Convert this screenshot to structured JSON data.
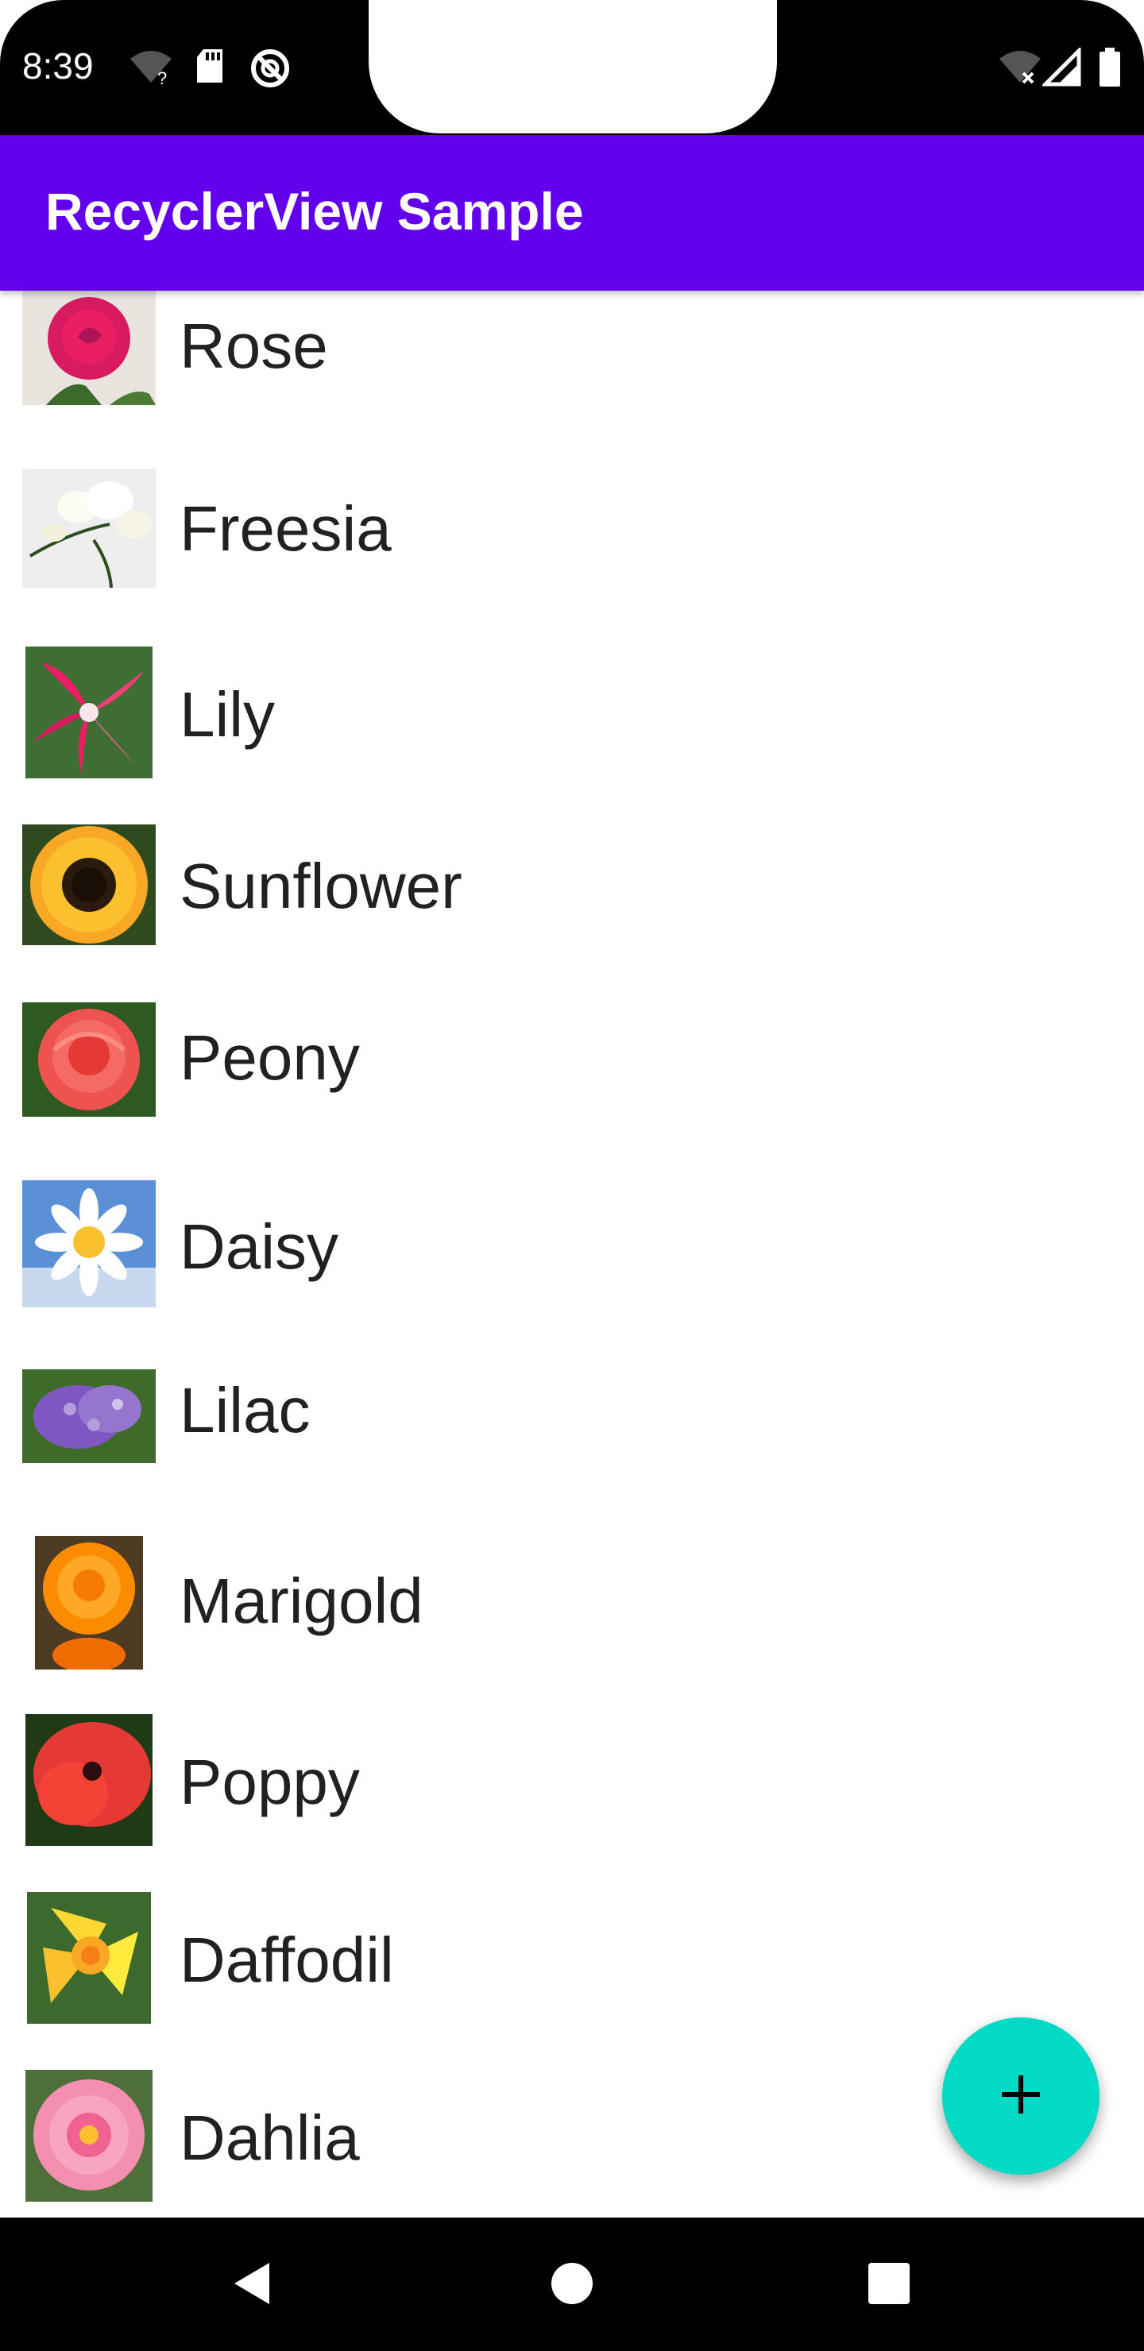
{
  "status_bar": {
    "time": "8:39",
    "icons": [
      "wifi-question-icon",
      "sd-card-icon",
      "do-not-disturb-icon",
      "wifi-off-icon",
      "cell-signal-icon",
      "battery-icon"
    ]
  },
  "app_bar": {
    "title": "RecyclerView Sample",
    "color": "#6200EE"
  },
  "flowers": [
    {
      "name": "Rose",
      "icon": "rose-image"
    },
    {
      "name": "Freesia",
      "icon": "freesia-image"
    },
    {
      "name": "Lily",
      "icon": "lily-image"
    },
    {
      "name": "Sunflower",
      "icon": "sunflower-image"
    },
    {
      "name": "Peony",
      "icon": "peony-image"
    },
    {
      "name": "Daisy",
      "icon": "daisy-image"
    },
    {
      "name": "Lilac",
      "icon": "lilac-image"
    },
    {
      "name": "Marigold",
      "icon": "marigold-image"
    },
    {
      "name": "Poppy",
      "icon": "poppy-image"
    },
    {
      "name": "Daffodil",
      "icon": "daffodil-image"
    },
    {
      "name": "Dahlia",
      "icon": "dahlia-image"
    }
  ],
  "fab": {
    "icon": "plus-icon",
    "color": "#03DAC5"
  },
  "nav_bar": {
    "icons": [
      "back-icon",
      "home-icon",
      "recents-icon"
    ]
  }
}
